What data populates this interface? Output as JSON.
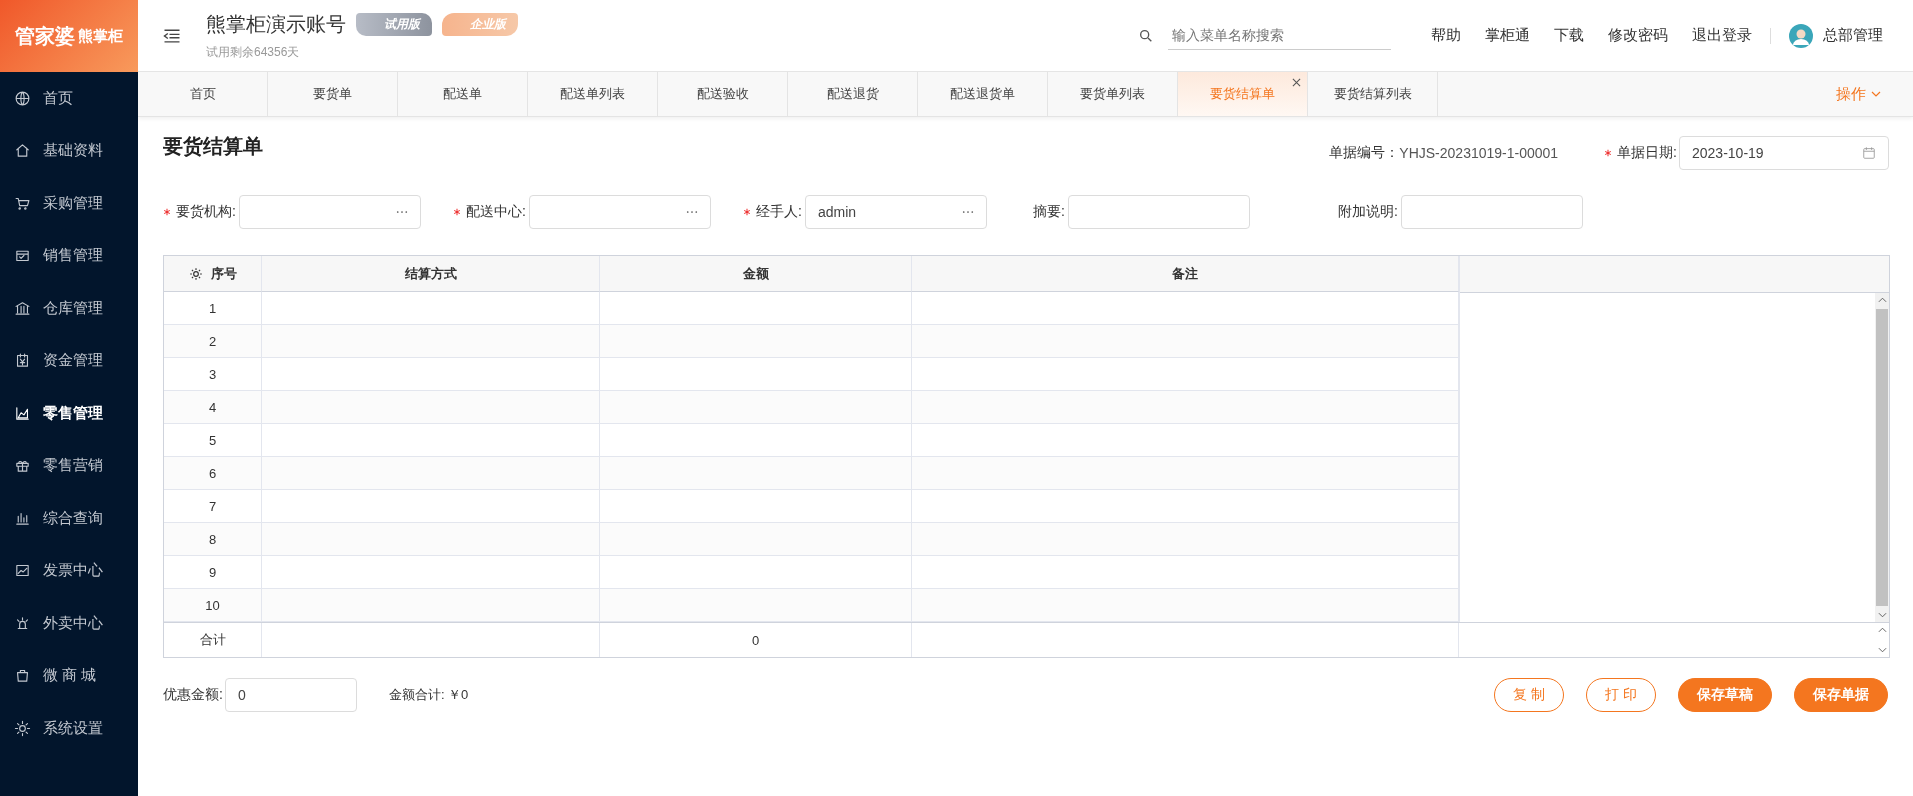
{
  "logo": {
    "main": "管家婆",
    "sub": "熊掌柜"
  },
  "sidebar": {
    "items": [
      {
        "label": "首页",
        "selected": false
      },
      {
        "label": "基础资料",
        "selected": false
      },
      {
        "label": "采购管理",
        "selected": false
      },
      {
        "label": "销售管理",
        "selected": false
      },
      {
        "label": "仓库管理",
        "selected": false
      },
      {
        "label": "资金管理",
        "selected": false
      },
      {
        "label": "零售管理",
        "selected": true
      },
      {
        "label": "零售营销",
        "selected": false
      },
      {
        "label": "综合查询",
        "selected": false
      },
      {
        "label": "发票中心",
        "selected": false
      },
      {
        "label": "外卖中心",
        "selected": false
      },
      {
        "label": "微 商 城",
        "selected": false
      },
      {
        "label": "系统设置",
        "selected": false
      }
    ]
  },
  "header": {
    "account": "熊掌柜演示账号",
    "trial_note": "试用剩余64356天",
    "badges": [
      {
        "label": "试用版",
        "kind": "trial"
      },
      {
        "label": "企业版",
        "kind": "enterprise"
      }
    ],
    "search": {
      "placeholder": "输入菜单名称搜索"
    },
    "links": [
      "帮助",
      "掌柜通",
      "下载",
      "修改密码",
      "退出登录"
    ],
    "user": "总部管理"
  },
  "tabs": [
    {
      "label": "首页",
      "selected": false
    },
    {
      "label": "要货单",
      "selected": false
    },
    {
      "label": "配送单",
      "selected": false
    },
    {
      "label": "配送单列表",
      "selected": false
    },
    {
      "label": "配送验收",
      "selected": false
    },
    {
      "label": "配送退货",
      "selected": false
    },
    {
      "label": "配送退货单",
      "selected": false
    },
    {
      "label": "要货单列表",
      "selected": false
    },
    {
      "label": "要货结算单",
      "selected": true
    },
    {
      "label": "要货结算列表",
      "selected": false
    }
  ],
  "tab_actions": "操作",
  "page": {
    "title": "要货结算单",
    "doc_number": {
      "label": "单据编号：",
      "value": "YHJS-20231019-1-00001"
    },
    "doc_date": {
      "label": "单据日期:",
      "value": "2023-10-19",
      "required": true
    },
    "fields": [
      {
        "label": "要货机构:",
        "required": true,
        "kind": "picker"
      },
      {
        "label": "配送中心:",
        "required": true,
        "kind": "picker"
      },
      {
        "label": "经手人:",
        "value": "admin",
        "required": true,
        "kind": "picker"
      },
      {
        "label": "摘要:",
        "required": false,
        "kind": "text"
      },
      {
        "label": "附加说明:",
        "required": false,
        "kind": "text"
      }
    ],
    "table": {
      "columns": [
        "序号",
        "结算方式",
        "金额",
        "备注"
      ],
      "rows": [
        "1",
        "2",
        "3",
        "4",
        "5",
        "6",
        "7",
        "8",
        "9",
        "10"
      ],
      "total": {
        "label": "合计",
        "amount": "0"
      }
    },
    "discount": {
      "label": "优惠金额:",
      "value": "0"
    },
    "amount_total": "金额合计: ￥0",
    "buttons": [
      {
        "label": "复 制",
        "kind": "outline"
      },
      {
        "label": "打 印",
        "kind": "outline"
      },
      {
        "label": "保存草稿",
        "kind": "primary"
      },
      {
        "label": "保存单据",
        "kind": "primary"
      }
    ]
  }
}
